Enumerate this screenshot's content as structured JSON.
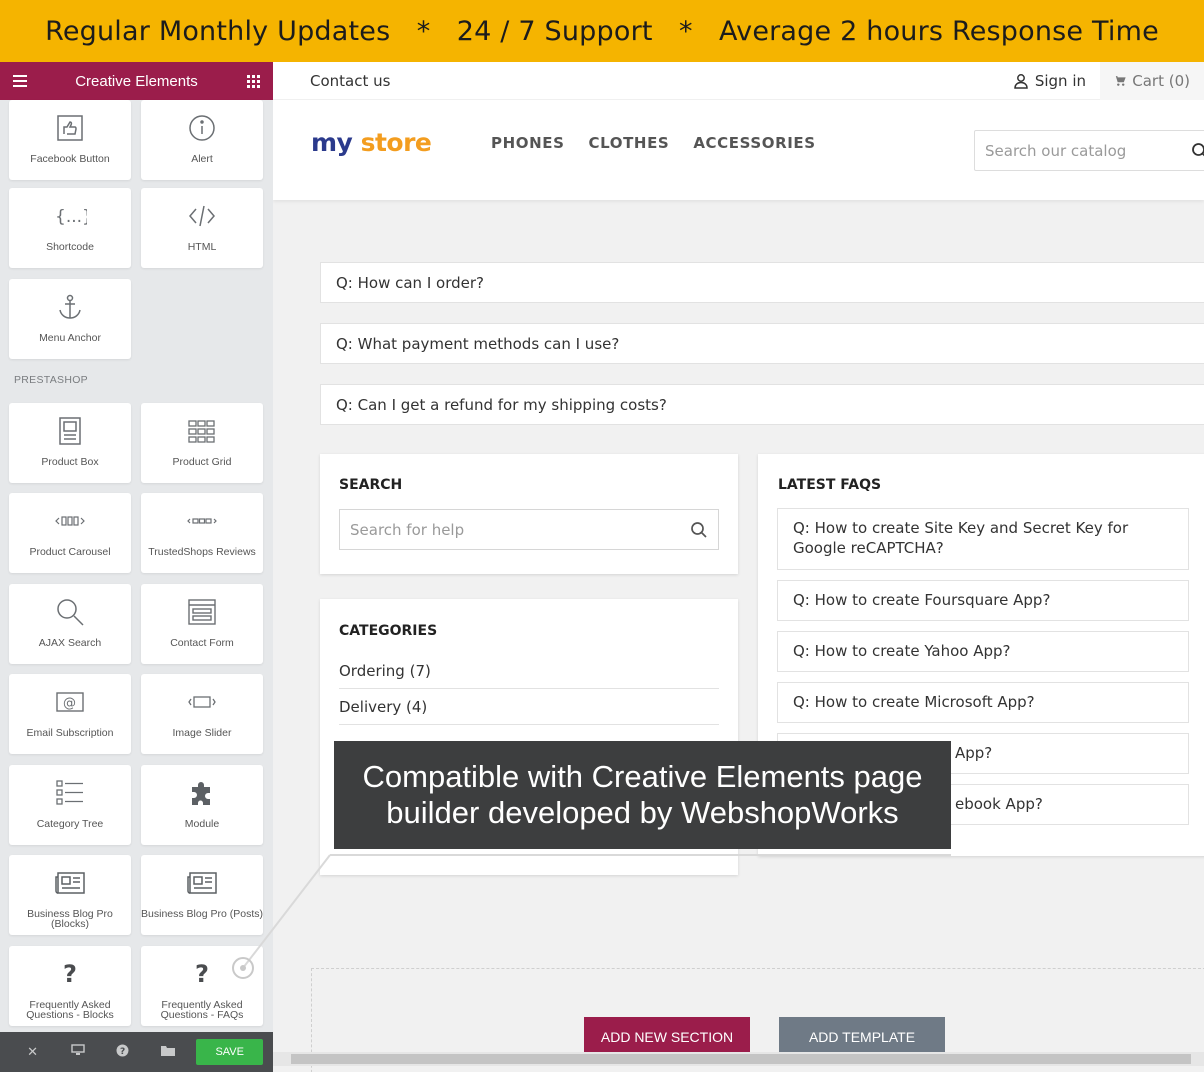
{
  "banner": {
    "text": "Regular Monthly Updates   *   24 / 7 Support   *   Average 2 hours Response Time"
  },
  "sidebar": {
    "title": "Creative Elements",
    "section_label": "PRESTASHOP",
    "tiles": [
      {
        "label": "Facebook Button",
        "icon": "thumbs-up-icon"
      },
      {
        "label": "Alert",
        "icon": "info-circle-icon"
      },
      {
        "label": "Shortcode",
        "icon": "braces-icon"
      },
      {
        "label": "HTML",
        "icon": "code-icon"
      },
      {
        "label": "Menu Anchor",
        "icon": "anchor-icon"
      },
      {
        "label": "Product Box",
        "icon": "product-box-icon"
      },
      {
        "label": "Product Grid",
        "icon": "product-grid-icon"
      },
      {
        "label": "Product Carousel",
        "icon": "carousel-icon"
      },
      {
        "label": "TrustedShops Reviews",
        "icon": "reviews-icon"
      },
      {
        "label": "AJAX Search",
        "icon": "search-icon"
      },
      {
        "label": "Contact Form",
        "icon": "contact-form-icon"
      },
      {
        "label": "Email Subscription",
        "icon": "email-icon"
      },
      {
        "label": "Image Slider",
        "icon": "image-slider-icon"
      },
      {
        "label": "Category Tree",
        "icon": "category-tree-icon"
      },
      {
        "label": "Module",
        "icon": "puzzle-icon"
      },
      {
        "label": "Business Blog Pro (Blocks)",
        "icon": "newspaper-icon"
      },
      {
        "label": "Business Blog Pro (Posts)",
        "icon": "newspaper-icon"
      },
      {
        "label": "Frequently Asked Questions - Blocks",
        "icon": "question-icon"
      },
      {
        "label": "Frequently Asked Questions - FAQs",
        "icon": "question-icon"
      }
    ],
    "footer": {
      "save_label": "SAVE"
    }
  },
  "store": {
    "contact": "Contact us",
    "signin": "Sign in",
    "cart": "Cart (0)",
    "logo_a": "my",
    "logo_b": "store",
    "menu": [
      "PHONES",
      "CLOTHES",
      "ACCESSORIES"
    ],
    "search_placeholder": "Search our catalog",
    "faq_questions": [
      "Q: How can I order?",
      "Q: What payment methods can I use?",
      "Q: Can I get a refund for my shipping costs?"
    ],
    "search_card": {
      "title": "SEARCH",
      "placeholder": "Search for help"
    },
    "categories_card": {
      "title": "CATEGORIES",
      "items": [
        "Ordering (7)",
        "Delivery (4)"
      ]
    },
    "latest_card": {
      "title": "LATEST FAQS",
      "items": [
        "Q: How to create Site Key and Secret Key for Google reCAPTCHA?",
        "Q: How to create Foursquare App?",
        "Q: How to create Yahoo App?",
        "Q: How to create Microsoft App?",
        "App?",
        "ebook App?"
      ]
    },
    "buttons": {
      "add_section": "ADD NEW SECTION",
      "add_template": "ADD TEMPLATE"
    }
  },
  "overlay": {
    "text": "Compatible with Creative Elements page builder developed by WebshopWorks"
  },
  "colors": {
    "banner": "#f5b400",
    "sidebar_head": "#9b1d4b",
    "save": "#39b54a",
    "add_section": "#9b1d4b",
    "add_template": "#6f7a86"
  }
}
